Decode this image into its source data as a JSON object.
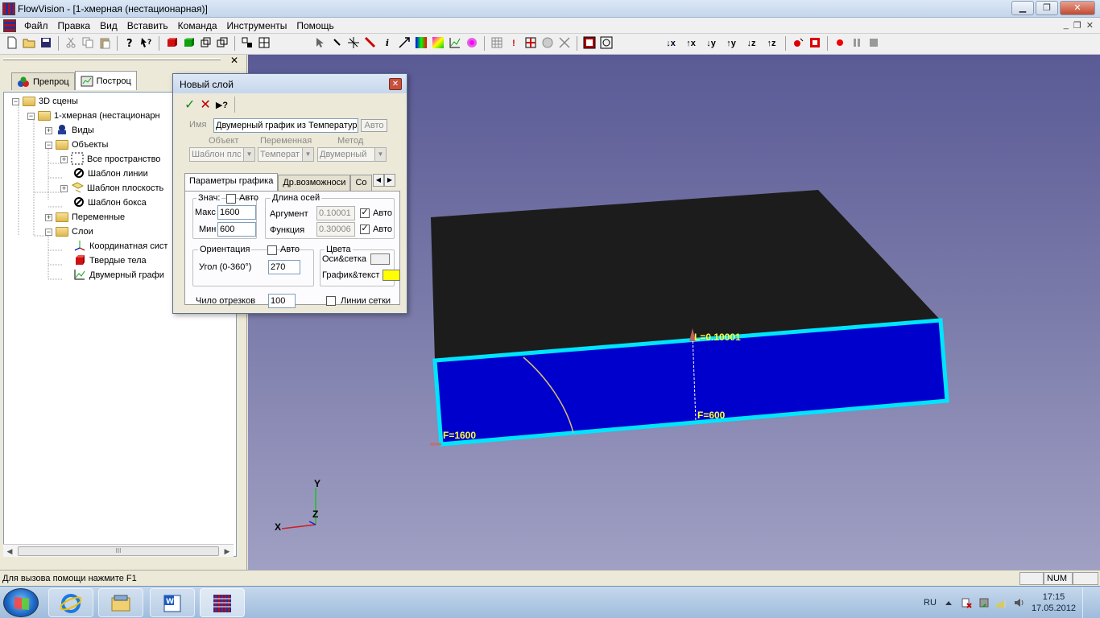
{
  "window": {
    "title": "FlowVision - [1-хмерная (нестационарная)]",
    "min": "▁",
    "max": "❐",
    "close": "✕"
  },
  "menu": [
    "Файл",
    "Правка",
    "Вид",
    "Вставить",
    "Команда",
    "Инструменты",
    "Помощь"
  ],
  "mdi": {
    "min": "_",
    "restore": "❐",
    "close": "✕"
  },
  "toolbar": {
    "axis_buttons": [
      "↓x",
      "↑x",
      "↓y",
      "↑y",
      "↓z",
      "↑z"
    ],
    "info": "i",
    "exclaim": "!"
  },
  "left_panel": {
    "close": "✕",
    "tabs": [
      "Препроц",
      "Построц"
    ],
    "tree": [
      {
        "label": "3D сцены",
        "expander": "−"
      },
      {
        "label": "1-хмерная (нестационарн",
        "expander": "−"
      },
      {
        "label": "Виды",
        "expander": "+"
      },
      {
        "label": "Объекты",
        "expander": "−"
      },
      {
        "label": "Все пространство",
        "expander": "+"
      },
      {
        "label": "Шаблон линии"
      },
      {
        "label": "Шаблон плоскость",
        "expander": "+"
      },
      {
        "label": "Шаблон бокса"
      },
      {
        "label": "Переменные",
        "expander": "+"
      },
      {
        "label": "Слои",
        "expander": "−"
      },
      {
        "label": "Координатная сист"
      },
      {
        "label": "Твердые тела"
      },
      {
        "label": "Двумерный графи"
      }
    ],
    "scroll_grip": "III"
  },
  "dialog": {
    "title": "Новый слой",
    "close": "✕",
    "help": "▶?",
    "name_label": "Имя",
    "name_value": "Двумерный график из Температур",
    "auto_button": "Авто",
    "object_label": "Объект",
    "object_value": "Шаблон плс",
    "variable_label": "Переменная",
    "variable_value": "Температ",
    "method_label": "Метод",
    "method_value": "Двумерный",
    "tabs": [
      "Параметры графика",
      "Др.возможноси",
      "Со"
    ],
    "values_group": "Знач:",
    "values_auto": "Авто",
    "max_label": "Макс",
    "max_value": "1600",
    "min_label": "Мин",
    "min_value": "600",
    "axes_group": "Длина осей",
    "argument_label": "Аргумент",
    "argument_value": "0.10001",
    "argument_auto": "Авто",
    "function_label": "Функция",
    "function_value": "0.30006",
    "function_auto": "Авто",
    "orientation_group": "Ориентация",
    "orientation_auto": "Авто",
    "angle_label": "Угол (0-360°)",
    "angle_value": "270",
    "colors_group": "Цвета",
    "axes_grid_label": "Оси&сетка",
    "plot_text_label": "График&текст",
    "segments_label": "Чило отрезков",
    "segments_value": "100",
    "grid_lines_label": "Линии сетки",
    "check": "✓",
    "colors": {
      "axes_grid": "#f0f0f0",
      "plot_text": "#ffff00"
    }
  },
  "viewport": {
    "label_arg": "L=0.10001",
    "label_f_min": "F=600",
    "label_f_max": "F=1600",
    "axis_x": "X",
    "axis_y": "Y",
    "axis_z": "Z",
    "colors": {
      "box_top": "#1c1c1c",
      "box_front": "#0000cc",
      "edge": "#00e5ff",
      "label": "#ffff33"
    }
  },
  "statusbar": {
    "hint": "Для вызова помощи нажмите F1",
    "num": "NUM"
  },
  "taskbar": {
    "lang": "RU",
    "time": "17:15",
    "date": "17.05.2012"
  }
}
